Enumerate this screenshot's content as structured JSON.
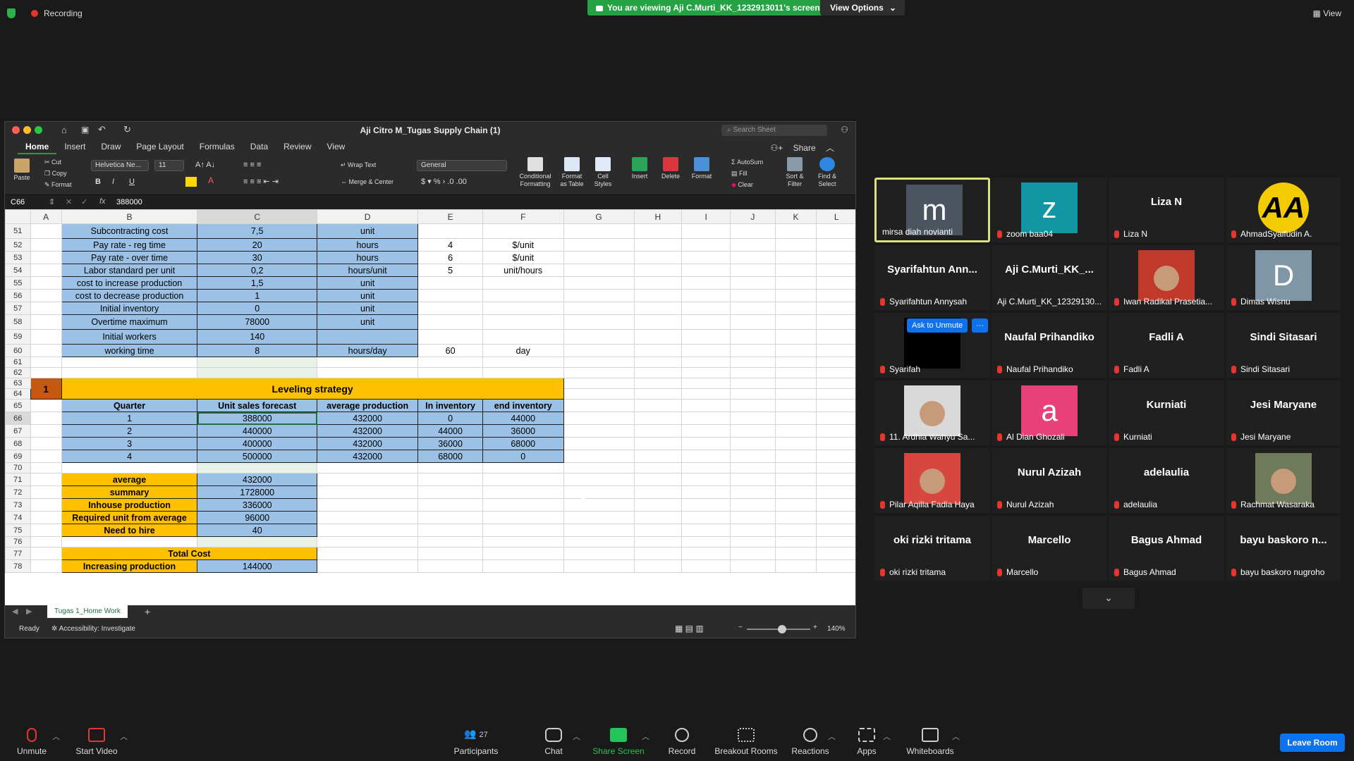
{
  "topbar": {
    "recording_label": "Recording",
    "viewing_text": "You are viewing Aji C.Murti_KK_1232913011's screen",
    "view_options_label": "View Options",
    "view_label": "View"
  },
  "excel": {
    "window_title": "Aji Citro M_Tugas Supply Chain (1)",
    "search_placeholder": "Search Sheet",
    "share_label": "Share",
    "tabs": [
      "Home",
      "Insert",
      "Draw",
      "Page Layout",
      "Formulas",
      "Data",
      "Review",
      "View"
    ],
    "ribbon": {
      "paste": "Paste",
      "cut": "Cut",
      "copy": "Copy",
      "format": "Format",
      "font_name": "Helvetica Ne...",
      "font_size": "11",
      "wrap_text": "Wrap Text",
      "merge_center": "Merge & Center",
      "number_format": "General",
      "conditional_formatting": "Conditional Formatting",
      "format_as_table": "Format as Table",
      "cell_styles": "Cell Styles",
      "insert": "Insert",
      "delete": "Delete",
      "format_cells": "Format",
      "autosum": "AutoSum",
      "fill": "Fill",
      "clear": "Clear",
      "sort_filter": "Sort & Filter",
      "find_select": "Find & Select"
    },
    "name_box": "C66",
    "formula_value": "388000",
    "columns": [
      "",
      "A",
      "B",
      "C",
      "D",
      "E",
      "F",
      "G",
      "H",
      "I",
      "J",
      "K",
      "L"
    ],
    "rows": [
      {
        "n": "51",
        "c": [
          "",
          "Subcontracting cost",
          "7,5",
          "unit",
          "",
          ""
        ]
      },
      {
        "n": "52",
        "c": [
          "",
          "Pay rate - reg time",
          "20",
          "hours",
          "4",
          "$/unit"
        ]
      },
      {
        "n": "53",
        "c": [
          "",
          "Pay rate - over time",
          "30",
          "hours",
          "6",
          "$/unit"
        ]
      },
      {
        "n": "54",
        "c": [
          "",
          "Labor standard per unit",
          "0,2",
          "hours/unit",
          "5",
          "unit/hours"
        ]
      },
      {
        "n": "55",
        "c": [
          "",
          "cost to increase production",
          "1,5",
          "unit",
          "",
          ""
        ]
      },
      {
        "n": "56",
        "c": [
          "",
          "cost to decrease production",
          "1",
          "unit",
          "",
          ""
        ]
      },
      {
        "n": "57",
        "c": [
          "",
          "Initial inventory",
          "0",
          "unit",
          "",
          ""
        ]
      },
      {
        "n": "58",
        "c": [
          "",
          "Overtime maximum",
          "78000",
          "unit",
          "",
          ""
        ]
      },
      {
        "n": "59",
        "c": [
          "",
          "Initial workers",
          "140",
          "",
          "",
          ""
        ]
      },
      {
        "n": "60",
        "c": [
          "",
          "working time",
          "8",
          "hours/day",
          "60",
          "day"
        ]
      },
      {
        "n": "61",
        "c": [
          "",
          "",
          "",
          "",
          "",
          ""
        ]
      },
      {
        "n": "62",
        "c": [
          "",
          "",
          "",
          "",
          "",
          ""
        ]
      },
      {
        "n": "63",
        "c": [
          "1",
          "Leveling strategy",
          "",
          "",
          "",
          ""
        ]
      },
      {
        "n": "64",
        "c": [
          "",
          "",
          "",
          "",
          "",
          ""
        ]
      },
      {
        "n": "65",
        "c": [
          "",
          "Quarter",
          "Unit sales forecast",
          "average production",
          "In inventory",
          "end inventory"
        ]
      },
      {
        "n": "66",
        "c": [
          "",
          "1",
          "388000",
          "432000",
          "0",
          "44000"
        ]
      },
      {
        "n": "67",
        "c": [
          "",
          "2",
          "440000",
          "432000",
          "44000",
          "36000"
        ]
      },
      {
        "n": "68",
        "c": [
          "",
          "3",
          "400000",
          "432000",
          "36000",
          "68000"
        ]
      },
      {
        "n": "69",
        "c": [
          "",
          "4",
          "500000",
          "432000",
          "68000",
          "0"
        ]
      },
      {
        "n": "70",
        "c": [
          "",
          "",
          "",
          "",
          "",
          ""
        ]
      },
      {
        "n": "71",
        "c": [
          "",
          "average",
          "432000",
          "",
          "",
          ""
        ]
      },
      {
        "n": "72",
        "c": [
          "",
          "summary",
          "1728000",
          "",
          "",
          ""
        ]
      },
      {
        "n": "73",
        "c": [
          "",
          "Inhouse production",
          "336000",
          "",
          "",
          ""
        ]
      },
      {
        "n": "74",
        "c": [
          "",
          "Required unit from average",
          "96000",
          "",
          "",
          ""
        ]
      },
      {
        "n": "75",
        "c": [
          "",
          "Need to hire",
          "40",
          "",
          "",
          ""
        ]
      },
      {
        "n": "76",
        "c": [
          "",
          "",
          "",
          "",
          "",
          ""
        ]
      },
      {
        "n": "77",
        "c": [
          "",
          "Total Cost",
          "",
          "",
          "",
          ""
        ]
      },
      {
        "n": "78",
        "c": [
          "",
          "Increasing production",
          "144000",
          "",
          "",
          ""
        ]
      }
    ],
    "sheet_tab": "Tugas 1_Home Work",
    "status_ready": "Ready",
    "status_accessibility": "Accessibility: Investigate",
    "zoom": "140%"
  },
  "participants": [
    {
      "big": "",
      "initial": "m",
      "avcolor": "#4a5560",
      "name": "mirsa diah novianti",
      "muted": false,
      "highlight": true
    },
    {
      "big": "",
      "initial": "z",
      "avcolor": "#1196a3",
      "name": "zoom baa04",
      "muted": true
    },
    {
      "big": "Liza N",
      "initial": "",
      "avcolor": "",
      "name": "Liza N",
      "muted": true
    },
    {
      "big": "",
      "initial": "AA",
      "avcolor": "#f2cb05",
      "name": "AhmadSyaifudin A.",
      "muted": true,
      "logo": true
    },
    {
      "big": "Syarifahtun Ann...",
      "initial": "",
      "avcolor": "",
      "name": "Syarifahtun Annysah",
      "muted": true
    },
    {
      "big": "Aji C.Murti_KK_...",
      "initial": "",
      "avcolor": "",
      "name": "Aji C.Murti_KK_12329130...",
      "muted": false
    },
    {
      "big": "",
      "initial": "",
      "avcolor": "#c0392b",
      "name": "Iwan Radikal Prasetia...",
      "muted": true,
      "photo": true
    },
    {
      "big": "",
      "initial": "D",
      "avcolor": "#7f96a6",
      "name": "Dimas Wisnu",
      "muted": true
    },
    {
      "big": "",
      "initial": "",
      "avcolor": "#000000",
      "name": "Syarifah",
      "muted": true
    },
    {
      "big": "Naufal Prihandiko",
      "initial": "",
      "avcolor": "",
      "name": "Naufal Prihandiko",
      "muted": true
    },
    {
      "big": "Fadli A",
      "initial": "",
      "avcolor": "",
      "name": "Fadli A",
      "muted": true
    },
    {
      "big": "Sindi Sitasari",
      "initial": "",
      "avcolor": "",
      "name": "Sindi Sitasari",
      "muted": true
    },
    {
      "big": "",
      "initial": "",
      "avcolor": "#d9d9d9",
      "name": "11. Ardhia Wahyu Sa...",
      "muted": true,
      "photo": true
    },
    {
      "big": "",
      "initial": "a",
      "avcolor": "#e8417a",
      "name": "Al Dian Ghozali",
      "muted": true
    },
    {
      "big": "Kurniati",
      "initial": "",
      "avcolor": "",
      "name": "Kurniati",
      "muted": true
    },
    {
      "big": "Jesi Maryane",
      "initial": "",
      "avcolor": "",
      "name": "Jesi Maryane",
      "muted": true
    },
    {
      "big": "",
      "initial": "",
      "avcolor": "#d8473f",
      "name": "Pilar Aqilla Fadia Haya",
      "muted": true,
      "photo": true
    },
    {
      "big": "Nurul Azizah",
      "initial": "",
      "avcolor": "",
      "name": "Nurul Azizah",
      "muted": true
    },
    {
      "big": "adelaulia",
      "initial": "",
      "avcolor": "",
      "name": "adelaulia",
      "muted": true
    },
    {
      "big": "",
      "initial": "",
      "avcolor": "#6f7a5a",
      "name": "Rachmat Wasaraka",
      "muted": true,
      "photo": true
    },
    {
      "big": "oki rizki tritama",
      "initial": "",
      "avcolor": "",
      "name": "oki rizki tritama",
      "muted": true
    },
    {
      "big": "Marcello",
      "initial": "",
      "avcolor": "",
      "name": "Marcello",
      "muted": true
    },
    {
      "big": "Bagus Ahmad",
      "initial": "",
      "avcolor": "",
      "name": "Bagus Ahmad",
      "muted": true
    },
    {
      "big": "bayu baskoro n...",
      "initial": "",
      "avcolor": "",
      "name": "bayu baskoro nugroho",
      "muted": true
    }
  ],
  "ask_to_unmute": "Ask to Unmute",
  "dots": "···",
  "bottombar": {
    "unmute": "Unmute",
    "start_video": "Start Video",
    "participants": "Participants",
    "participants_count": "27",
    "chat": "Chat",
    "share_screen": "Share Screen",
    "record": "Record",
    "breakout": "Breakout Rooms",
    "reactions": "Reactions",
    "apps": "Apps",
    "whiteboards": "Whiteboards",
    "leave": "Leave Room"
  }
}
